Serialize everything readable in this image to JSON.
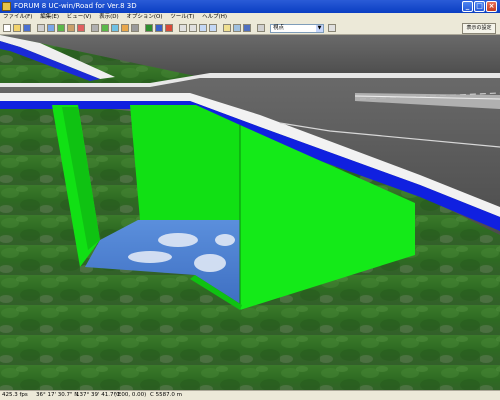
{
  "window": {
    "title": "FORUM 8 UC-win/Road for Ver.8 3D",
    "minimize": "_",
    "maximize": "□",
    "close": "×"
  },
  "menu": {
    "items": [
      "ファイル(F)",
      "編集(E)",
      "ビュー(V)",
      "表示(D)",
      "オプション(O)",
      "ツール(T)",
      "ヘルプ(H)"
    ]
  },
  "toolbar": {
    "view_select": "視点",
    "right_button": "表示の設定"
  },
  "status": {
    "fps": "425.3 fps",
    "lat": "36° 17' 30.7\" N",
    "lon": "137° 39' 41.7\" E",
    "coords": "(0.00, 0.00)",
    "elev": "C 5587.0 m"
  },
  "scene": {
    "colors": {
      "terrain": "#2f6a22",
      "green_wall": "#11e014",
      "green_wall_dark": "#0fc212",
      "road": "#5a5a5a",
      "road_edge_white": "#f2f2f2",
      "road_edge_blue": "#1020e0",
      "sky": "#4f7fcf"
    }
  }
}
